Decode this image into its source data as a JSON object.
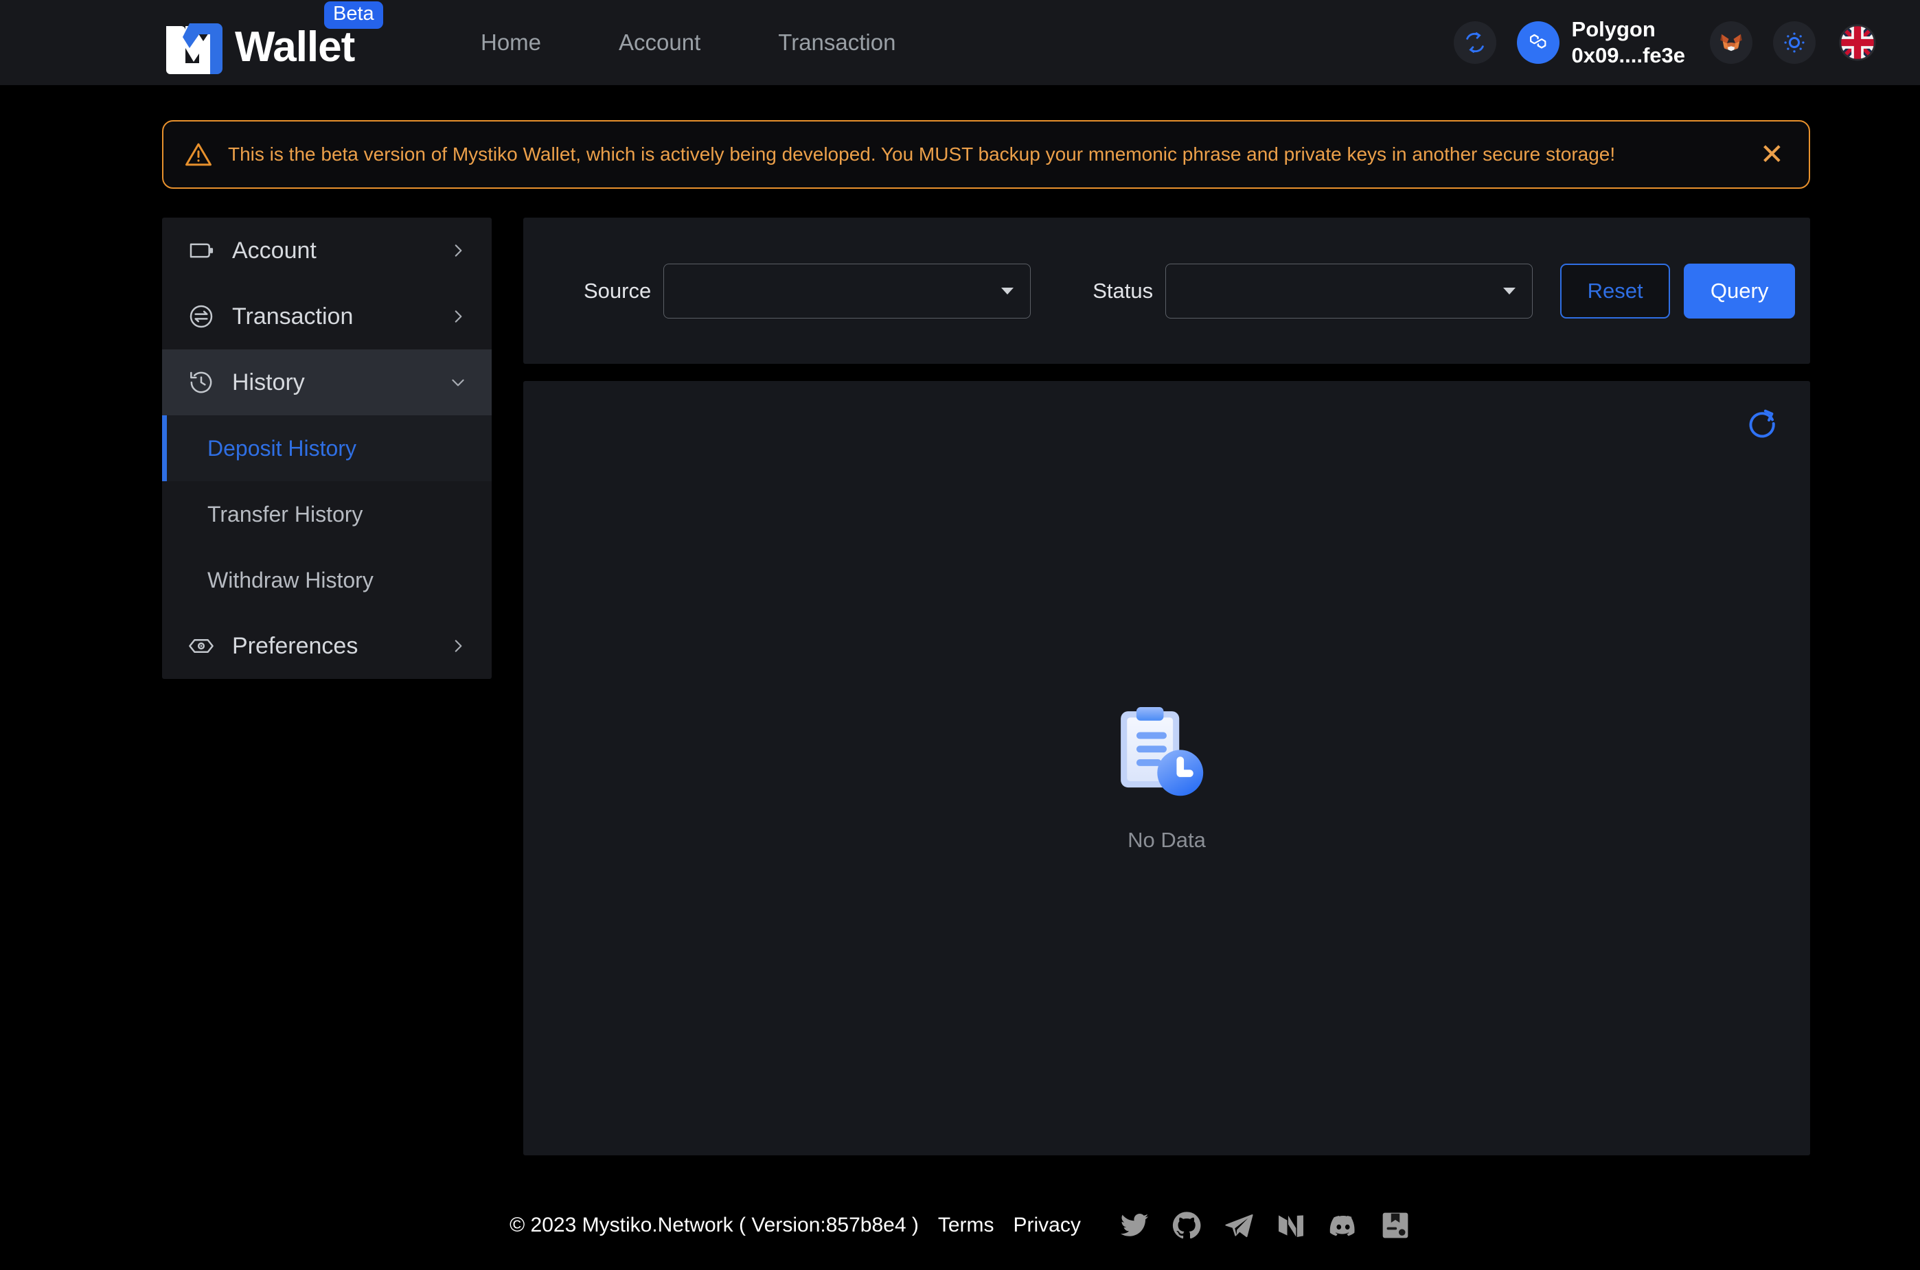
{
  "header": {
    "brand_name": "Wallet",
    "beta_badge": "Beta",
    "logo_icon": "mystiko-m-logo-icon",
    "nav": [
      {
        "label": "Home",
        "icon": ""
      },
      {
        "label": "Account",
        "icon": ""
      },
      {
        "label": "Transaction",
        "icon": ""
      }
    ],
    "sync_icon": "sync-refresh-icon",
    "chain": {
      "icon": "polygon-chain-icon",
      "name": "Polygon",
      "address": "0x09....fe3e"
    },
    "wallet_icon": "metamask-fox-icon",
    "theme_icon": "sun-theme-icon",
    "language_icon": "uk-flag-icon"
  },
  "banner": {
    "icon": "warning-triangle-icon",
    "message": "This is the beta version of Mystiko Wallet, which is actively being developed. You MUST backup your mnemonic phrase and private keys in another secure storage!",
    "close_icon": "close-icon",
    "accent_color": "#e8912d"
  },
  "sidebar": {
    "items": [
      {
        "label": "Account",
        "icon": "wallet-icon",
        "chevron": "chevron-right-icon",
        "expanded": false
      },
      {
        "label": "Transaction",
        "icon": "transaction-swap-icon",
        "chevron": "chevron-right-icon",
        "expanded": false
      },
      {
        "label": "History",
        "icon": "history-clock-icon",
        "chevron": "chevron-down-icon",
        "expanded": true
      },
      {
        "label": "Preferences",
        "icon": "preferences-eye-icon",
        "chevron": "chevron-right-icon",
        "expanded": false
      }
    ],
    "history_children": [
      {
        "label": "Deposit History",
        "selected": true
      },
      {
        "label": "Transfer History",
        "selected": false
      },
      {
        "label": "Withdraw History",
        "selected": false
      }
    ],
    "active_color": "#2f6fe4"
  },
  "filters": {
    "source": {
      "label": "Source",
      "value": "",
      "placeholder": "",
      "caret_icon": "caret-down-icon"
    },
    "status": {
      "label": "Status",
      "value": "",
      "placeholder": "",
      "caret_icon": "caret-down-icon"
    },
    "reset_label": "Reset",
    "query_label": "Query"
  },
  "content": {
    "refresh_icon": "refresh-icon",
    "empty_icon": "clipboard-clock-icon",
    "empty_text": "No Data"
  },
  "footer": {
    "copyright": "© 2023 Mystiko.Network ( Version:857b8e4 )",
    "links": [
      {
        "label": "Terms"
      },
      {
        "label": "Privacy"
      }
    ],
    "social": [
      {
        "name": "twitter-icon"
      },
      {
        "name": "github-icon"
      },
      {
        "name": "telegram-icon"
      },
      {
        "name": "medium-icon"
      },
      {
        "name": "discord-icon"
      },
      {
        "name": "docs-book-icon"
      }
    ]
  },
  "colors": {
    "page_bg": "#000000",
    "panel_bg": "#16181d",
    "header_bg": "#17181c",
    "accent_blue": "#2f72f5",
    "warning": "#e8912d"
  }
}
